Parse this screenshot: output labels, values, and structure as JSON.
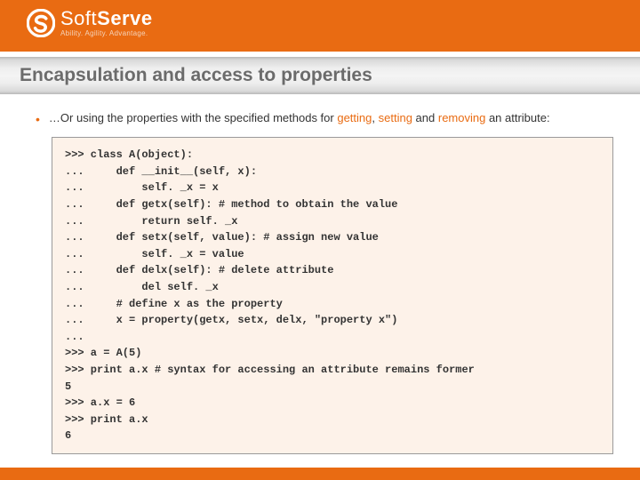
{
  "brand": {
    "name_light": "Soft",
    "name_bold": "Serve",
    "tagline": "Ability. Agility. Advantage."
  },
  "title": "Encapsulation and access to properties",
  "bullet": {
    "prefix": "…Or using the properties with the specified methods for ",
    "word1": "getting",
    "sep1": ", ",
    "word2": "setting",
    "sep2": " and ",
    "word3": "removing",
    "suffix": " an attribute:"
  },
  "code": ">>> class A(object):\n...     def __init__(self, x):\n...         self. _x = x\n...     def getx(self): # method to obtain the value\n...         return self. _x\n...     def setx(self, value): # assign new value\n...         self. _x = value\n...     def delx(self): # delete attribute\n...         del self. _x\n...     # define x as the property\n...     x = property(getx, setx, delx, \"property x\")\n...\n>>> a = A(5)\n>>> print a.x # syntax for accessing an attribute remains former\n5\n>>> a.x = 6\n>>> print a.x\n6"
}
